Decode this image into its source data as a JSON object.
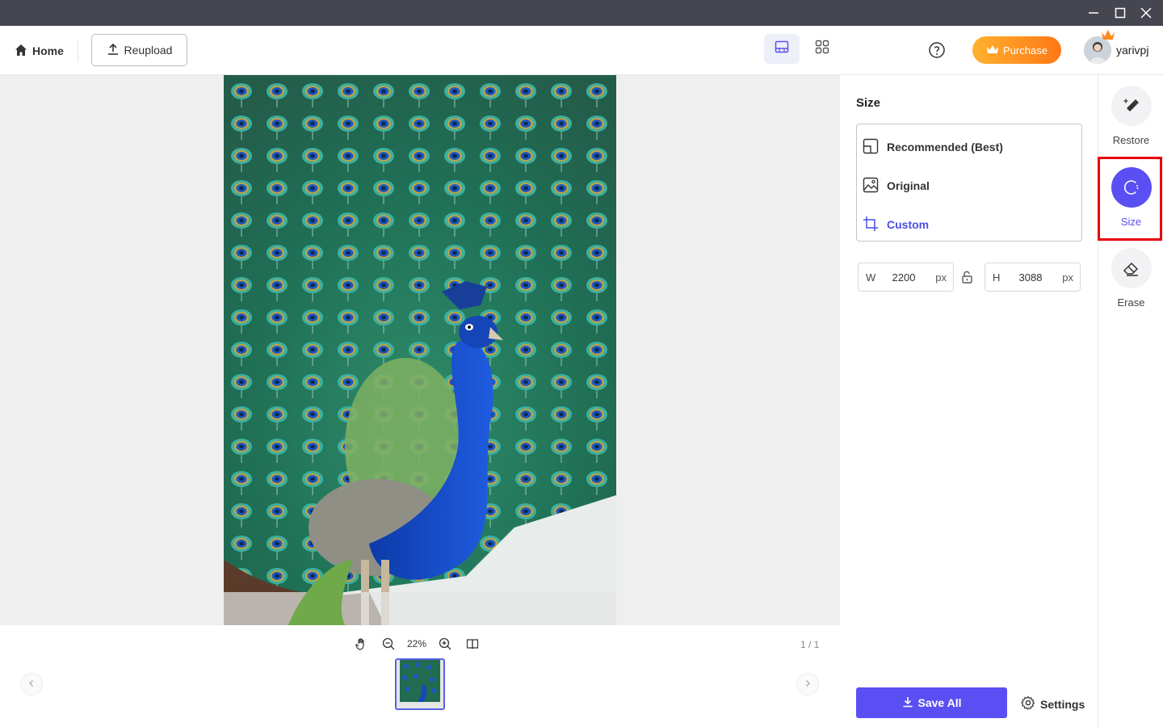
{
  "window": {
    "controls": [
      "minimize-icon",
      "maximize-icon",
      "close-icon"
    ]
  },
  "toolbar": {
    "home_label": "Home",
    "reupload_label": "Reupload",
    "purchase_label": "Purchase",
    "username": "yarivpj"
  },
  "canvas": {
    "zoom": "22%",
    "page_indicator": "1 / 1"
  },
  "panel": {
    "title": "Size",
    "options": [
      {
        "label": "Recommended (Best)",
        "icon": "recommended-layout-icon",
        "selected": false
      },
      {
        "label": "Original",
        "icon": "image-icon",
        "selected": false
      },
      {
        "label": "Custom",
        "icon": "crop-icon",
        "selected": true
      }
    ],
    "width": {
      "label": "W",
      "value": "2200",
      "unit": "px"
    },
    "height": {
      "label": "H",
      "value": "3088",
      "unit": "px"
    },
    "save_all_label": "Save All",
    "settings_label": "Settings"
  },
  "rail": {
    "tools": [
      {
        "label": "Restore",
        "icon": "restore-brush-icon",
        "active": false
      },
      {
        "label": "Size",
        "icon": "size-circle-icon",
        "active": true
      },
      {
        "label": "Erase",
        "icon": "eraser-icon",
        "active": false
      }
    ]
  },
  "colors": {
    "accent": "#5a4ff2",
    "purchase_start": "#ffb12e",
    "purchase_end": "#ff7816",
    "highlight": "#e8000b"
  }
}
